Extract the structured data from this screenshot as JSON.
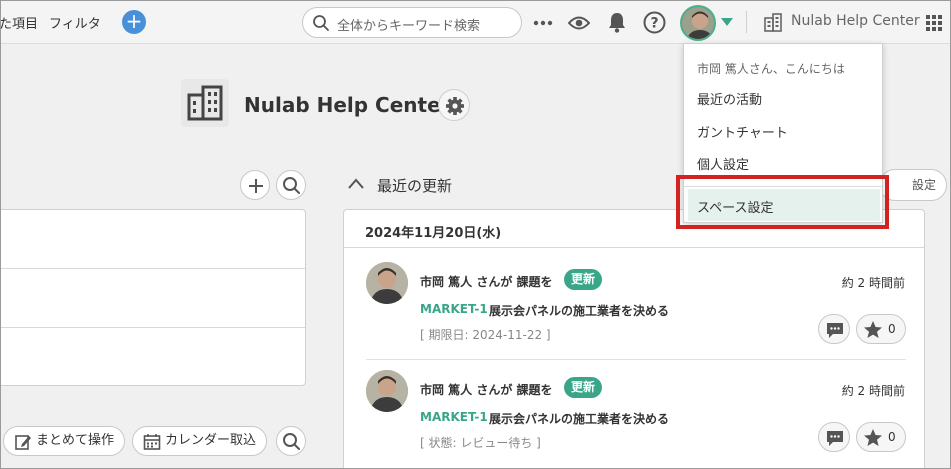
{
  "topbar": {
    "nav_item_1": "た項目",
    "nav_item_2": "フィルタ",
    "search_placeholder": "全体からキーワード検索",
    "space_name": "Nulab Help Center"
  },
  "project": {
    "title": "Nulab Help Center"
  },
  "left_panel": {
    "bulk_action_label": "まとめて操作",
    "calendar_import_label": "カレンダー取込"
  },
  "recent": {
    "section_title": "最近の更新",
    "settings_label": "設定",
    "date_heading": "2024年11月20日(水)",
    "entries": [
      {
        "actor": "市岡 篤人 さんが 課題を",
        "badge": "更新",
        "time": "約 2 時間前",
        "issue_key": "MARKET-1",
        "summary": "展示会パネルの施工業者を決める",
        "meta": "[ 期限日: 2024-11-22 ]",
        "stars": "0"
      },
      {
        "actor": "市岡 篤人 さんが 課題を",
        "badge": "更新",
        "time": "約 2 時間前",
        "issue_key": "MARKET-1",
        "summary": "展示会パネルの施工業者を決める",
        "meta": "[ 状態: レビュー待ち ]",
        "stars": "0"
      }
    ]
  },
  "user_menu": {
    "greeting": "市岡 篤人さん、こんにちは",
    "items": [
      "最近の活動",
      "ガントチャート",
      "個人設定",
      "スペース設定"
    ]
  },
  "colors": {
    "accent_green": "#3aa689",
    "highlight_red": "#d32222",
    "plus_blue": "#4a90d9"
  }
}
